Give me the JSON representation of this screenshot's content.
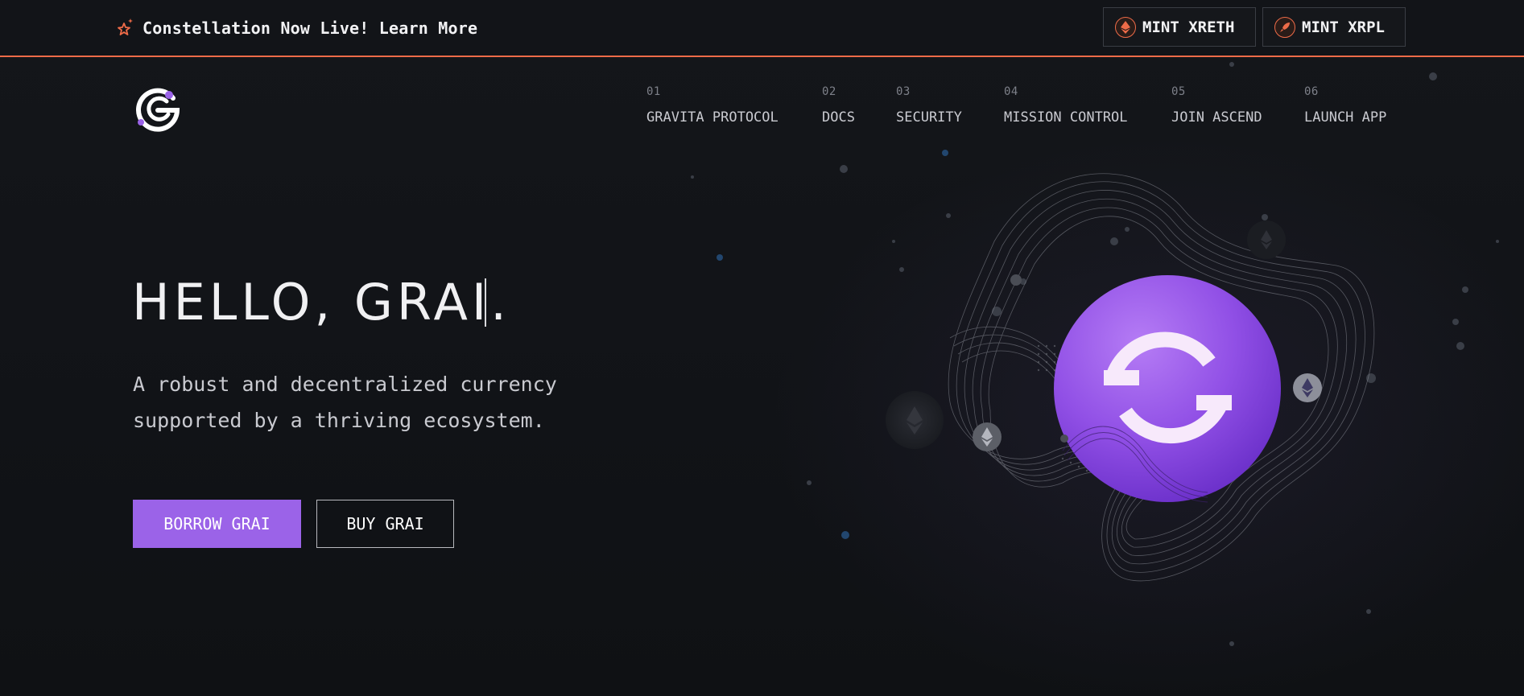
{
  "topbar": {
    "announcement": "Constellation Now Live! Learn More",
    "buttons": [
      {
        "label": "MINT XRETH",
        "icon": "ethereum-icon"
      },
      {
        "label": "MINT XRPL",
        "icon": "rocket-icon"
      }
    ]
  },
  "brand": {
    "logo": "gravita-logo-icon"
  },
  "nav": {
    "items": [
      {
        "num": "01",
        "label": "GRAVITA PROTOCOL"
      },
      {
        "num": "02",
        "label": "DOCS"
      },
      {
        "num": "03",
        "label": "SECURITY"
      },
      {
        "num": "04",
        "label": "MISSION CONTROL"
      },
      {
        "num": "05",
        "label": "JOIN ASCEND"
      },
      {
        "num": "06",
        "label": "LAUNCH APP"
      }
    ]
  },
  "hero": {
    "title": "HELLO, GRAI.",
    "subtitle": "A robust and decentralized currency supported by a thriving ecosystem.",
    "primary_button": "BORROW GRAI",
    "secondary_button": "BUY GRAI"
  },
  "colors": {
    "accent": "#9b63e8",
    "announce_border": "#ee6b48",
    "background": "#121418"
  }
}
